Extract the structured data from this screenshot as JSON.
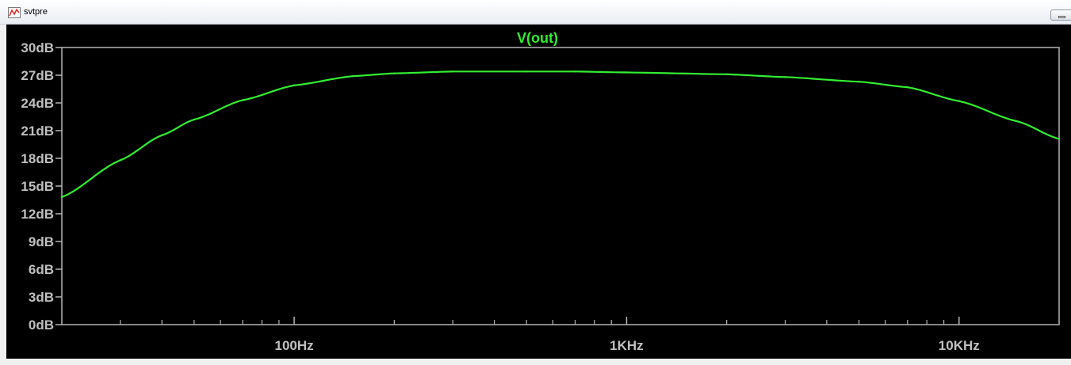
{
  "window": {
    "title": "svtpre"
  },
  "colors": {
    "background": "#000000",
    "axis": "#b4b4b4",
    "trace": "#33ee33",
    "chrome": "#f0f0f0"
  },
  "chart_data": {
    "type": "line",
    "title": "V(out)",
    "x_scale": "log",
    "x_unit": "Hz",
    "xlim": [
      20,
      20000
    ],
    "ylim": [
      0,
      30
    ],
    "y_ticks": [
      {
        "value": 30,
        "label": "30dB"
      },
      {
        "value": 27,
        "label": "27dB"
      },
      {
        "value": 24,
        "label": "24dB"
      },
      {
        "value": 21,
        "label": "21dB"
      },
      {
        "value": 18,
        "label": "18dB"
      },
      {
        "value": 15,
        "label": "15dB"
      },
      {
        "value": 12,
        "label": "12dB"
      },
      {
        "value": 9,
        "label": "9dB"
      },
      {
        "value": 6,
        "label": "6dB"
      },
      {
        "value": 3,
        "label": "3dB"
      },
      {
        "value": 0,
        "label": "0dB"
      }
    ],
    "x_major_ticks": [
      {
        "value": 100,
        "label": "100Hz"
      },
      {
        "value": 1000,
        "label": "1KHz"
      },
      {
        "value": 10000,
        "label": "10KHz"
      }
    ],
    "x_minor_ticks": [
      30,
      40,
      50,
      60,
      70,
      80,
      90,
      200,
      300,
      400,
      500,
      600,
      700,
      800,
      900,
      2000,
      3000,
      4000,
      5000,
      6000,
      7000,
      8000,
      9000
    ],
    "grid": false,
    "series": [
      {
        "name": "V(out)",
        "color": "#33ee33",
        "x": [
          20,
          30,
          40,
          50,
          70,
          100,
          150,
          200,
          300,
          500,
          700,
          1000,
          2000,
          3000,
          5000,
          7000,
          10000,
          15000,
          20000
        ],
        "y": [
          13.8,
          17.8,
          20.5,
          22.2,
          24.3,
          25.9,
          26.9,
          27.2,
          27.4,
          27.4,
          27.4,
          27.3,
          27.1,
          26.8,
          26.3,
          25.7,
          24.2,
          22.0,
          20.1
        ]
      }
    ]
  }
}
